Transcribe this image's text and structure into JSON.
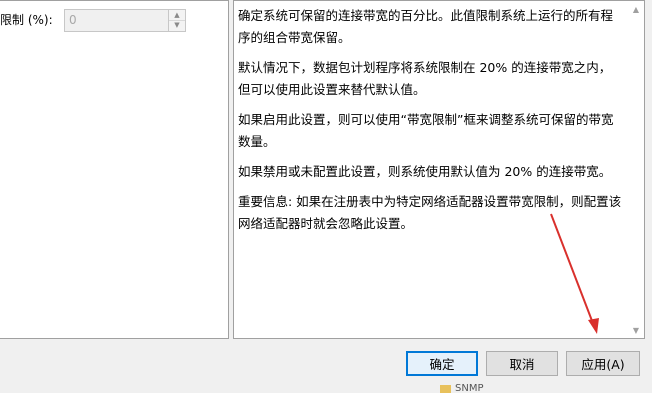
{
  "options": {
    "bandwidth_label": "限制 (%):",
    "bandwidth_value": "0"
  },
  "help": {
    "paragraphs": [
      "确定系统可保留的连接带宽的百分比。此值限制系统上运行的所有程序的组合带宽保留。",
      "默认情况下，数据包计划程序将系统限制在 20% 的连接带宽之内，但可以使用此设置来替代默认值。",
      "如果启用此设置，则可以使用“带宽限制”框来调整系统可保留的带宽数量。",
      "如果禁用或未配置此设置，则系统使用默认值为 20% 的连接带宽。",
      "重要信息: 如果在注册表中为特定网络适配器设置带宽限制，则配置该网络适配器时就会忽略此设置。"
    ]
  },
  "buttons": {
    "ok": "确定",
    "cancel": "取消",
    "apply": "应用(A)"
  },
  "background": {
    "item_label": "SNMP"
  },
  "annotation": {
    "arrow_color": "#d9302c"
  }
}
